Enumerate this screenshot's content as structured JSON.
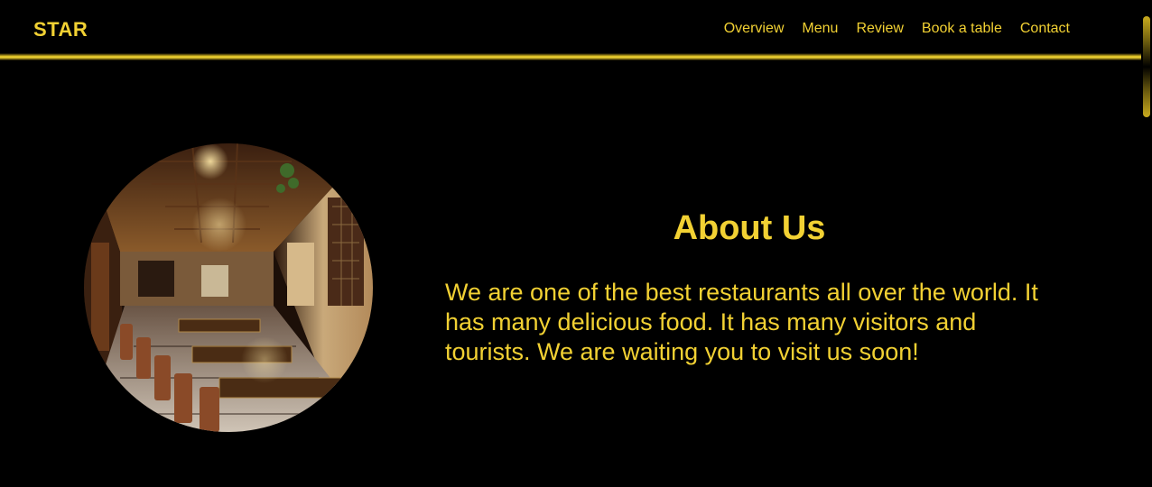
{
  "brand": {
    "name": "STAR"
  },
  "nav": {
    "items": [
      {
        "label": "Overview"
      },
      {
        "label": "Menu"
      },
      {
        "label": "Review"
      },
      {
        "label": "Book a table"
      },
      {
        "label": "Contact"
      }
    ]
  },
  "about": {
    "title": "About Us",
    "text": "We are one of the best restaurants all over the world. It has many delicious food. It has many visitors and tourists. We are waiting you to visit us soon!"
  },
  "colors": {
    "background": "#000000",
    "accent": "#f2d133"
  }
}
